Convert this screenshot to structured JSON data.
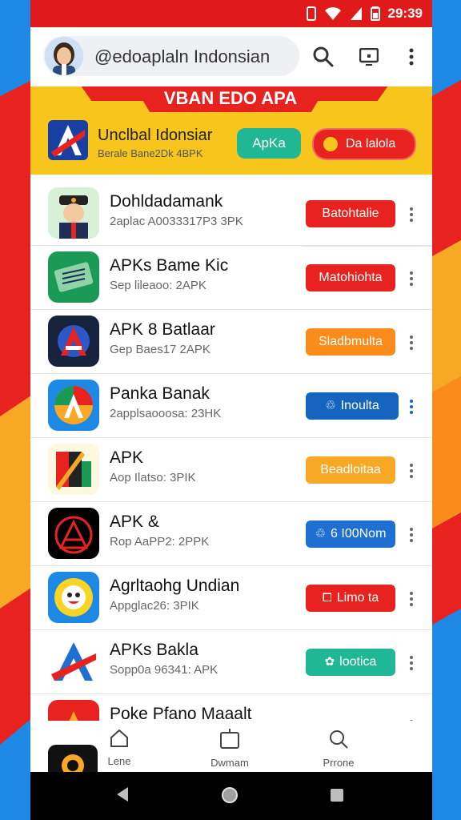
{
  "status_bar": {
    "time": "29:39"
  },
  "search": {
    "text": "@edoaplaln Indonsian"
  },
  "banner": {
    "ribbon": "VBAN EDO APA",
    "title": "Unclbal Idonsiar",
    "subtitle": "Berale Bane2Dk 4BPK",
    "primary_button": "ApKa",
    "secondary_button": "Da lalola"
  },
  "apps": [
    {
      "title": "Dohldadamank",
      "subtitle": "2aplac A0033317P3 3PK",
      "action": "Batohtalie",
      "color": "#e8231f"
    },
    {
      "title": "APKs Bame Kic",
      "subtitle": "Sep lileaoo: 2APK",
      "action": "Matohiohta",
      "color": "#e8231f"
    },
    {
      "title": "APK 8 Batlaar",
      "subtitle": "Gep Baes17 2APK",
      "action": "Sladbmulta",
      "color": "#fb8c1c"
    },
    {
      "title": "Panka Banak",
      "subtitle": "2applsaooosa: 23HK",
      "action": "Inoulta",
      "color": "#1565c0"
    },
    {
      "title": "APK",
      "subtitle": "Aop Ilatso: 3PIK",
      "action": "Beadloitaa",
      "color": "#f9a825"
    },
    {
      "title": "APK &",
      "subtitle": "Rop AaPP2: 2PPK",
      "action": "6 I00Nom",
      "color": "#1e6fd1"
    },
    {
      "title": "Agrltaohg Undian",
      "subtitle": "Appglac26: 3PIK",
      "action": "Limo ta",
      "color": "#e8231f"
    },
    {
      "title": "APKs Bakla",
      "subtitle": "Sopp0a 96341: APK",
      "action": "lootica",
      "color": "#20b894"
    },
    {
      "title": "Poke Pfano Maaalt",
      "subtitle": "",
      "action": "",
      "color": "#e8231f"
    }
  ],
  "bottom_nav": [
    {
      "label": "Lene",
      "icon": "home-icon"
    },
    {
      "label": "Dwmam",
      "icon": "box-icon"
    },
    {
      "label": "Prrone",
      "icon": "search-icon"
    }
  ]
}
